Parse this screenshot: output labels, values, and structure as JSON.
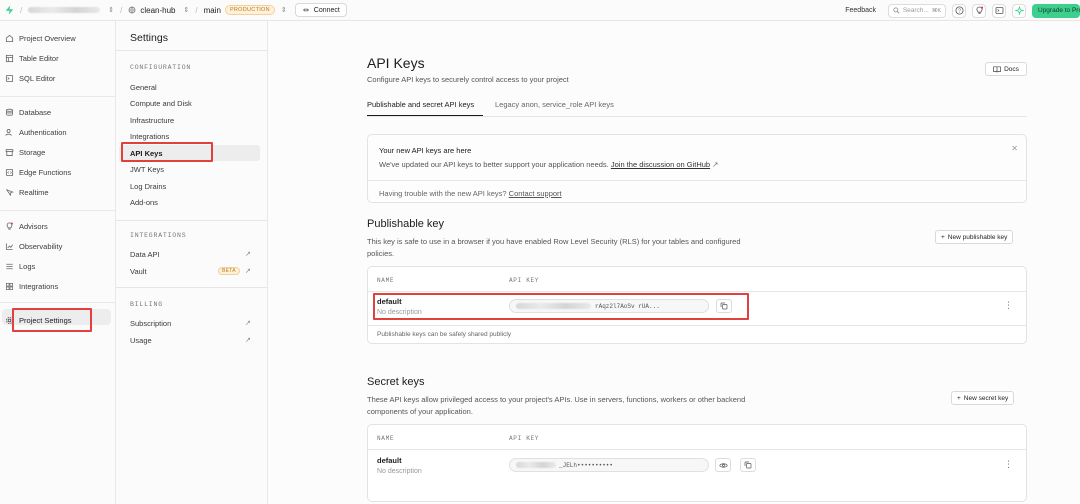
{
  "topbar": {
    "project": "clean-hub",
    "branch": "main",
    "env_badge": "PRODUCTION",
    "connect_label": "Connect",
    "feedback_label": "Feedback",
    "search_placeholder": "Search...",
    "search_shortcut": "⌘K",
    "upgrade_label": "Upgrade to Pro"
  },
  "sidebar": {
    "items": [
      {
        "label": "Project Overview",
        "icon": "home-icon"
      },
      {
        "label": "Table Editor",
        "icon": "table-icon"
      },
      {
        "label": "SQL Editor",
        "icon": "terminal-icon"
      },
      {
        "label": "Database",
        "icon": "database-icon"
      },
      {
        "label": "Authentication",
        "icon": "users-icon"
      },
      {
        "label": "Storage",
        "icon": "archive-icon"
      },
      {
        "label": "Edge Functions",
        "icon": "code-icon"
      },
      {
        "label": "Realtime",
        "icon": "realtime-icon"
      },
      {
        "label": "Advisors",
        "icon": "lightbulb-icon"
      },
      {
        "label": "Observability",
        "icon": "chart-icon"
      },
      {
        "label": "Logs",
        "icon": "list-icon"
      },
      {
        "label": "Integrations",
        "icon": "blocks-icon"
      },
      {
        "label": "Project Settings",
        "icon": "gear-icon"
      }
    ]
  },
  "settings": {
    "title": "Settings",
    "configuration_heading": "CONFIGURATION",
    "configuration_items": [
      "General",
      "Compute and Disk",
      "Infrastructure",
      "Integrations",
      "API Keys",
      "JWT Keys",
      "Log Drains",
      "Add-ons"
    ],
    "integrations_heading": "INTEGRATIONS",
    "integrations_items": [
      "Data API",
      "Vault"
    ],
    "vault_badge": "BETA",
    "billing_heading": "BILLING",
    "billing_items": [
      "Subscription",
      "Usage"
    ]
  },
  "main": {
    "title": "API Keys",
    "subtitle": "Configure API keys to securely control access to your project",
    "docs_label": "Docs",
    "tabs": [
      "Publishable and secret API keys",
      "Legacy anon, service_role API keys"
    ],
    "notice": {
      "title": "Your new API keys are here",
      "body": "We've updated our API keys to better support your application needs.",
      "link": "Join the discussion on GitHub",
      "footer_text": "Having trouble with the new API keys?",
      "footer_link": "Contact support"
    },
    "publishable": {
      "heading": "Publishable key",
      "description": "This key is safe to use in a browser if you have enabled Row Level Security (RLS) for your tables and configured policies.",
      "new_button": "New publishable key",
      "col_name": "NAME",
      "col_key": "API KEY",
      "row_name": "default",
      "row_desc": "No description",
      "key_visible": "rAqz2l7AoSv     rUA...",
      "footer": "Publishable keys can be safely shared publicly"
    },
    "secret": {
      "heading": "Secret keys",
      "description": "These API keys allow privileged access to your project's APIs. Use in servers, functions, workers or other backend components of your application.",
      "new_button": "New secret key",
      "col_name": "NAME",
      "col_key": "API KEY",
      "row_name": "default",
      "row_desc": "No description",
      "key_visible": "_JELh••••••••••"
    }
  },
  "colors": {
    "accent": "#3ecf8e",
    "highlight_box": "#e0413f",
    "badge_text": "#c07a12"
  }
}
